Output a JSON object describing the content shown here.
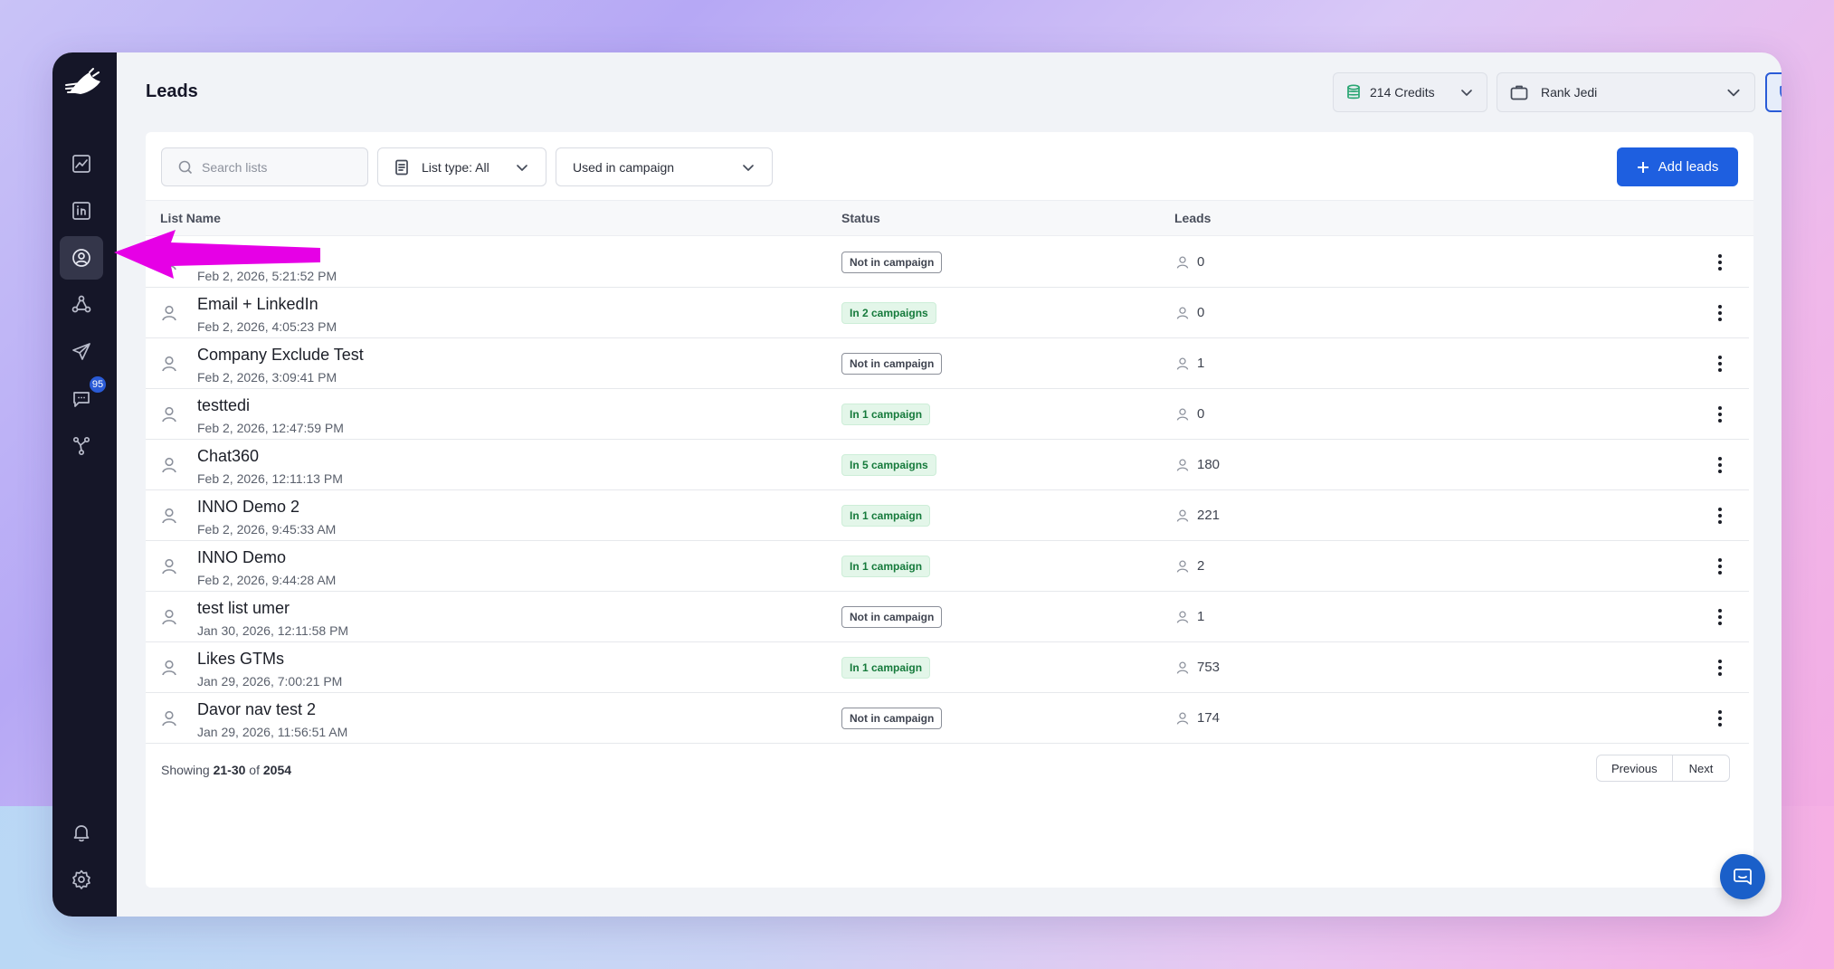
{
  "page": {
    "title": "Leads"
  },
  "header": {
    "credits_label": "214 Credits",
    "workspace_label": "Rank Jedi"
  },
  "sidebar": {
    "messages_badge": "95"
  },
  "toolbar": {
    "search_placeholder": "Search lists",
    "list_type_label": "List type: All",
    "campaign_filter_label": "Used in campaign",
    "add_leads_label": "Add leads"
  },
  "table": {
    "columns": {
      "name": "List Name",
      "status": "Status",
      "leads": "Leads"
    },
    "rows": [
      {
        "name": "",
        "date": "Feb 2, 2026, 5:21:52 PM",
        "status": "Not in campaign",
        "status_type": "grey",
        "leads": "0"
      },
      {
        "name": "Email + LinkedIn",
        "date": "Feb 2, 2026, 4:05:23 PM",
        "status": "In 2 campaigns",
        "status_type": "green",
        "leads": "0"
      },
      {
        "name": "Company Exclude Test",
        "date": "Feb 2, 2026, 3:09:41 PM",
        "status": "Not in campaign",
        "status_type": "grey",
        "leads": "1"
      },
      {
        "name": "testtedi",
        "date": "Feb 2, 2026, 12:47:59 PM",
        "status": "In 1 campaign",
        "status_type": "green",
        "leads": "0"
      },
      {
        "name": "Chat360",
        "date": "Feb 2, 2026, 12:11:13 PM",
        "status": "In 5 campaigns",
        "status_type": "green",
        "leads": "180"
      },
      {
        "name": "INNO Demo 2",
        "date": "Feb 2, 2026, 9:45:33 AM",
        "status": "In 1 campaign",
        "status_type": "green",
        "leads": "221"
      },
      {
        "name": "INNO Demo",
        "date": "Feb 2, 2026, 9:44:28 AM",
        "status": "In 1 campaign",
        "status_type": "green",
        "leads": "2"
      },
      {
        "name": "test list umer",
        "date": "Jan 30, 2026, 12:11:58 PM",
        "status": "Not in campaign",
        "status_type": "grey",
        "leads": "1"
      },
      {
        "name": "Likes GTMs",
        "date": "Jan 29, 2026, 7:00:21 PM",
        "status": "In 1 campaign",
        "status_type": "green",
        "leads": "753"
      },
      {
        "name": "Davor nav test 2",
        "date": "Jan 29, 2026, 11:56:51 AM",
        "status": "Not in campaign",
        "status_type": "grey",
        "leads": "174"
      }
    ]
  },
  "footer": {
    "showing_prefix": "Showing",
    "range": "21-30",
    "of_label": "of",
    "total": "2054",
    "prev_label": "Previous",
    "next_label": "Next"
  },
  "colors": {
    "sidebar": "#151628",
    "accent": "#1e5fe0",
    "annotation_arrow": "#e600e6",
    "status_green_bg": "#e3f6e9"
  }
}
